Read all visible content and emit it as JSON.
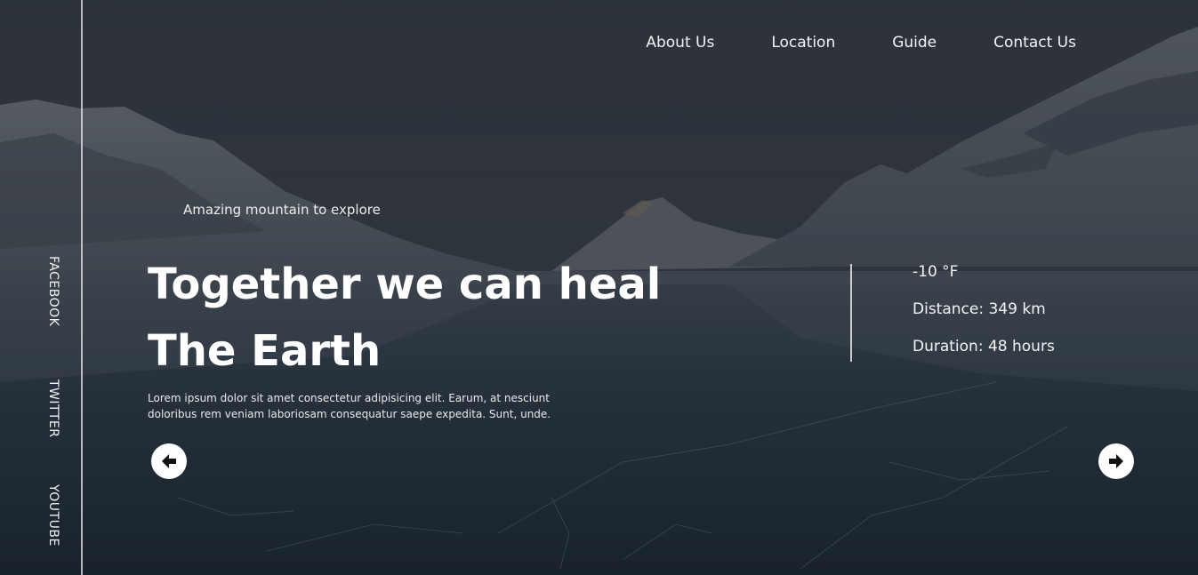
{
  "nav": {
    "items": [
      "About Us",
      "Location",
      "Guide",
      "Contact Us"
    ]
  },
  "social": {
    "facebook": "FACEBOOK",
    "twitter": "TWITTER",
    "youtube": "YOUTUBE"
  },
  "hero": {
    "tagline": "Amazing mountain to explore",
    "headline_line1": "Together we can heal",
    "headline_line2": "The Earth",
    "description": "Lorem ipsum dolor sit amet consectetur adipisicing elit. Earum, at nesciunt doloribus rem veniam laboriosam consequatur saepe expedita. Sunt, unde."
  },
  "stats": {
    "temperature": "-10 °F",
    "distance": "Distance: 349 km",
    "duration": "Duration: 48 hours"
  },
  "icons": {
    "prev": "arrow-left-icon",
    "next": "arrow-right-icon"
  },
  "colors": {
    "text": "#ffffff",
    "overlay": "#2f353d",
    "button": "#ffffff"
  }
}
